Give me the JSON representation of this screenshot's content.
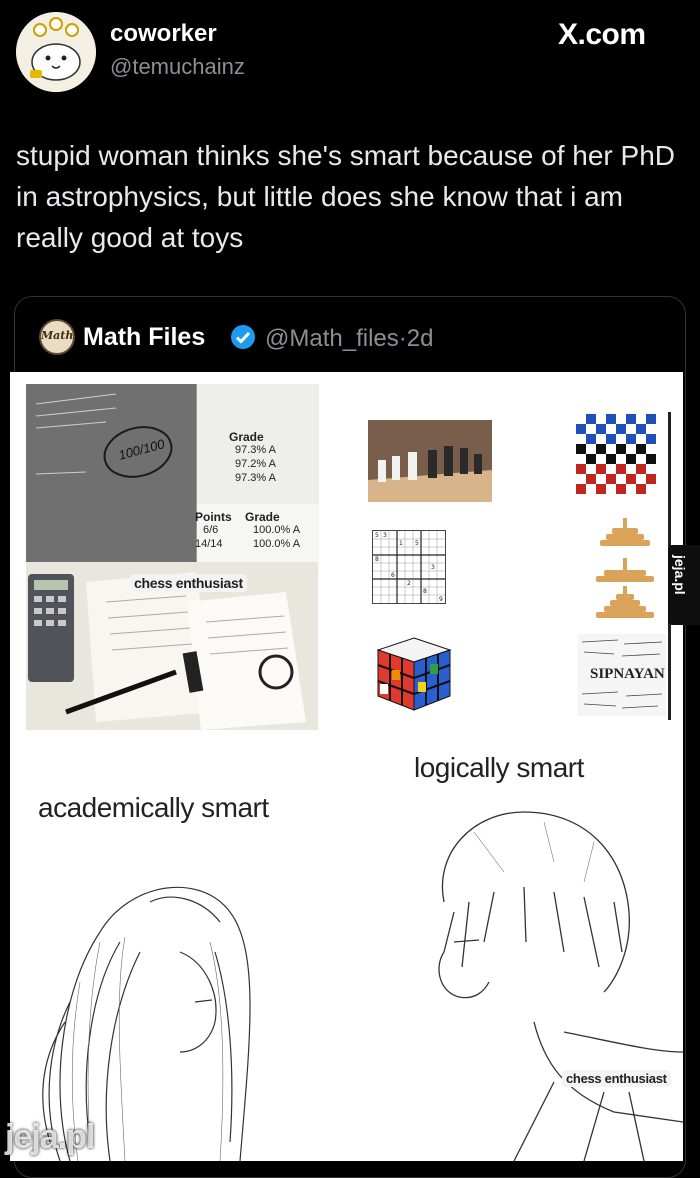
{
  "header": {
    "display_name": "coworker",
    "handle": "@temuchainz",
    "site": "X.com"
  },
  "tweet": {
    "text": "stupid woman thinks she's smart because of her PhD in astrophysics, but little does she know that i am really good at toys"
  },
  "quote": {
    "display_name": "Math Files",
    "handle": "@Math_files",
    "separator": "·",
    "age": "2d",
    "avatar_text": "Math"
  },
  "meme": {
    "left_caption": "academically smart",
    "right_caption": "logically smart",
    "chess_label": "chess enthusiast",
    "sipnayan_label": "SIPNAYAN",
    "grades": {
      "header1": "Grade",
      "rows1": [
        "97.3%  A",
        "97.2%  A",
        "97.3%  A"
      ],
      "points_header": "Points",
      "grade_header": "Grade",
      "rows2": [
        [
          "6/6",
          "100.0% A"
        ],
        [
          "14/14",
          "100.0% A"
        ]
      ],
      "exam_score": "100/100"
    }
  },
  "watermark": {
    "side": "jeja.pl",
    "bottom": "jeja.pl"
  },
  "colors": {
    "background": "#000000",
    "muted": "#8b8f94",
    "verified": "#1d9bf0",
    "card_border": "#2f3336"
  }
}
